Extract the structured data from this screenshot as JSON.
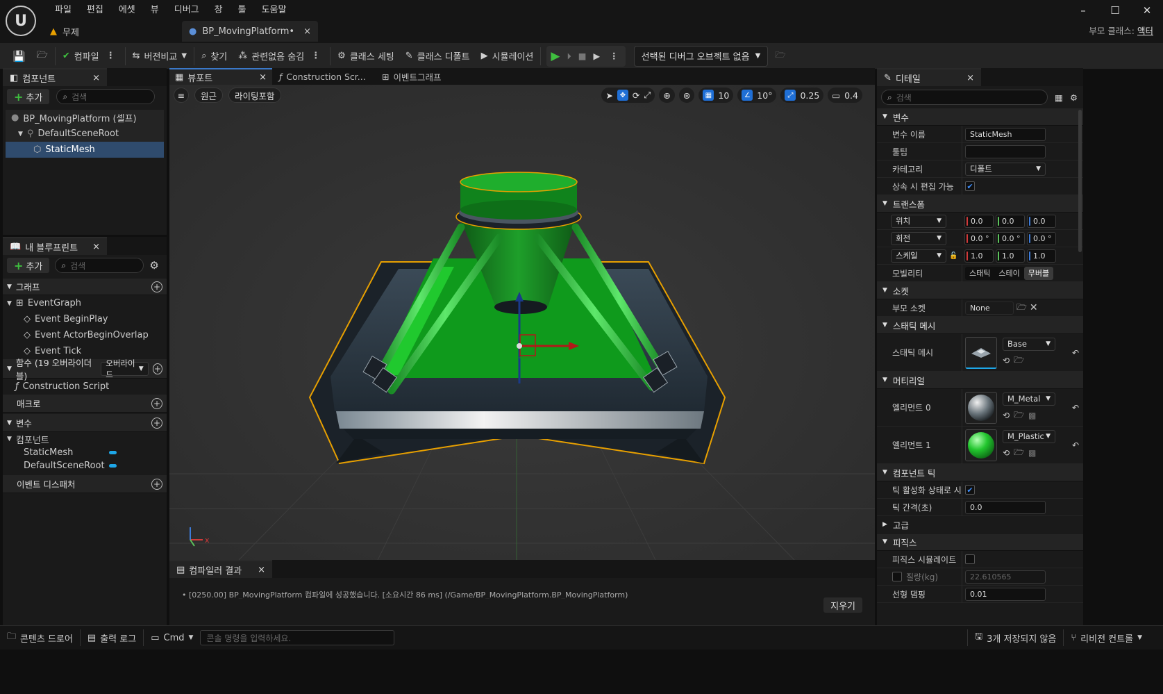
{
  "menu": [
    "파일",
    "편집",
    "에셋",
    "뷰",
    "디버그",
    "창",
    "툴",
    "도움말"
  ],
  "doc_tabs": [
    {
      "label": "무제"
    },
    {
      "label": "BP_MovingPlatform•"
    }
  ],
  "parent_class": {
    "label": "부모 클래스:",
    "value": "액터"
  },
  "toolbar": {
    "compile": "컴파일",
    "diff": "버전비교",
    "find": "찾기",
    "hide_unrelated": "관련없음 숨김",
    "class_settings": "클래스 세팅",
    "class_defaults": "클래스 디폴트",
    "simulation": "시뮬레이션",
    "debug_selector": "선택된 디버그 오브젝트 없음"
  },
  "components_panel": {
    "title": "컴포넌트",
    "add": "추가",
    "search_placeholder": "검색",
    "tree": [
      "BP_MovingPlatform (셀프)",
      "DefaultSceneRoot",
      "StaticMesh"
    ]
  },
  "my_blueprint": {
    "title": "내 블루프린트",
    "add": "추가",
    "search_placeholder": "검색",
    "graphs_header": "그래프",
    "event_graph": "EventGraph",
    "events": [
      "Event BeginPlay",
      "Event ActorBeginOverlap",
      "Event Tick"
    ],
    "functions_header": "함수 (19 오버라이더블)",
    "override_btn": "오버라이드",
    "construction_script": "Construction Script",
    "macros_header": "매크로",
    "variables_header": "변수",
    "components_group": "컴포넌트",
    "component_vars": [
      "StaticMesh",
      "DefaultSceneRoot"
    ],
    "dispatchers_header": "이벤트 디스패처"
  },
  "viewport_tabs": [
    "뷰포트",
    "Construction Scr...",
    "이벤트그래프"
  ],
  "viewport_toolbar": {
    "perspective": "원근",
    "lit": "라이팅포함",
    "grid_snap": "10",
    "rot_snap": "10°",
    "scale_snap": "0.25",
    "cam_speed": "0.4"
  },
  "compiler": {
    "title": "컴파일러 결과",
    "message": "[0250.00] BP_MovingPlatform 컴파일에 성공했습니다. [소요시간 86 ms] (/Game/BP_MovingPlatform.BP_MovingPlatform)",
    "clear": "지우기"
  },
  "details": {
    "title": "디테일",
    "search_placeholder": "검색",
    "sec_variable": "변수",
    "var_name_label": "변수 이름",
    "var_name_value": "StaticMesh",
    "tooltip_label": "툴팁",
    "category_label": "카테고리",
    "category_value": "디폴트",
    "editable_label": "상속 시 편집 가능",
    "sec_transform": "트랜스폼",
    "location": {
      "label": "위치",
      "x": "0.0",
      "y": "0.0",
      "z": "0.0"
    },
    "rotation": {
      "label": "회전",
      "x": "0.0 °",
      "y": "0.0 °",
      "z": "0.0 °"
    },
    "scale": {
      "label": "스케일",
      "x": "1.0",
      "y": "1.0",
      "z": "1.0"
    },
    "mobility_label": "모빌리티",
    "mobility_opts": [
      "스태틱",
      "스테이",
      "무버블"
    ],
    "sec_sockets": "소켓",
    "parent_socket_label": "부모 소켓",
    "parent_socket_value": "None",
    "sec_static_mesh": "스태틱 메시",
    "static_mesh_label": "스태틱 메시",
    "static_mesh_value": "Base",
    "sec_materials": "머티리얼",
    "element0_label": "엘리먼트 0",
    "element0_value": "M_Metal",
    "element1_label": "엘리먼트 1",
    "element1_value": "M_Plastic",
    "sec_component_tick": "컴포넌트 틱",
    "tick_enabled_label": "틱 활성화 상태로 시...",
    "tick_interval_label": "틱 간격(초)",
    "tick_interval_value": "0.0",
    "sec_advanced": "고급",
    "sec_physics": "피직스",
    "simulate_label": "피직스 시뮬레이트",
    "mass_label": "질량(kg)",
    "mass_value": "22.610565",
    "linear_damping_label": "선형 댐핑",
    "linear_damping_value": "0.01"
  },
  "statusbar": {
    "content_drawer": "콘텐츠 드로어",
    "output_log": "출력 로그",
    "cmd": "Cmd",
    "cmd_placeholder": "콘솔 명령을 입력하세요.",
    "unsaved": "3개 저장되지 않음",
    "revision": "리비전 컨트롤"
  },
  "colors": {
    "accent_green": "#3fbf3f",
    "selection": "#2f4b6d",
    "orange_outline": "#e8a000"
  }
}
